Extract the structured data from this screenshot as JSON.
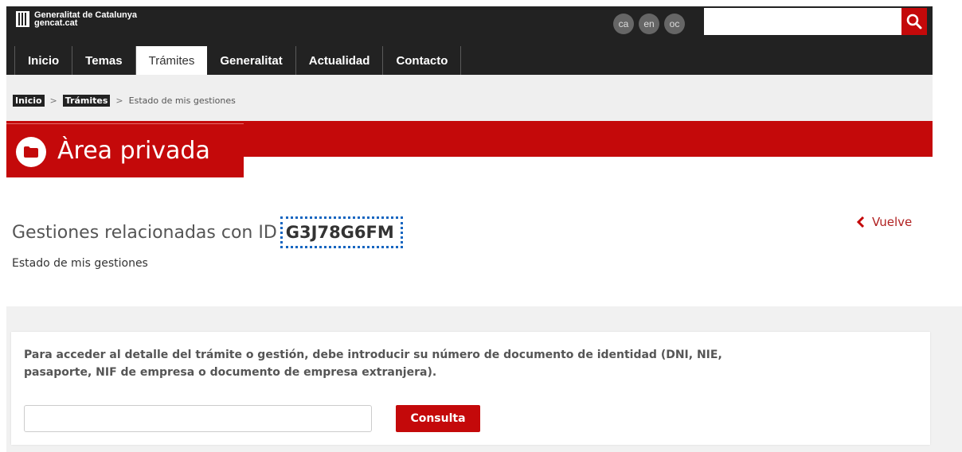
{
  "header": {
    "logo_line1": "Generalitat de Catalunya",
    "logo_line2": "gencat.cat",
    "languages": [
      "ca",
      "en",
      "oc"
    ],
    "search_placeholder": "",
    "accent_color": "#c4090a"
  },
  "nav": {
    "items": [
      "Inicio",
      "Temas",
      "Trámites",
      "Generalitat",
      "Actualidad",
      "Contacto"
    ],
    "active": "Trámites"
  },
  "breadcrumb": {
    "items": [
      "Inicio",
      "Trámites"
    ],
    "current": "Estado de mis gestiones",
    "separator": ">"
  },
  "banner": {
    "title": "Àrea privada",
    "icon": "folder-icon"
  },
  "main": {
    "heading_prefix": "Gestiones relacionadas con ID",
    "heading_id": "G3J78G6FM",
    "subtitle": "Estado de mis gestiones",
    "back_label": "Vuelve",
    "instructions": "Para acceder al detalle del trámite o gestión, debe introducir su número de documento de identidad (DNI, NIE, pasaporte, NIF de empresa o documento de empresa extranjera).",
    "document_input_value": "",
    "submit_label": "Consulta"
  }
}
